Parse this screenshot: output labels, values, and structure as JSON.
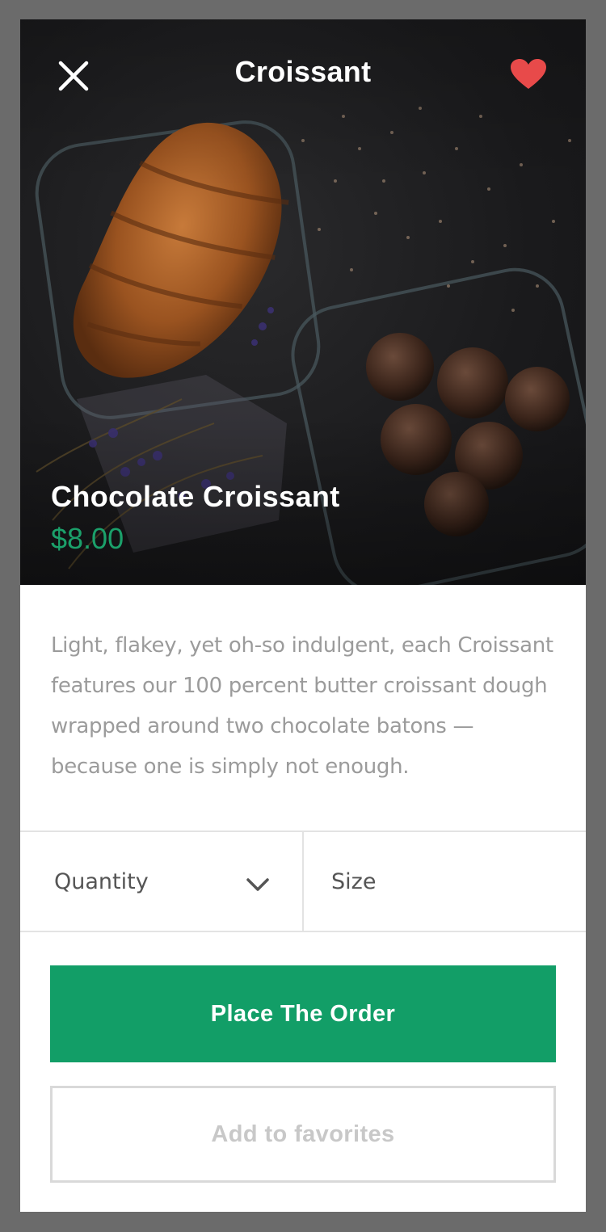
{
  "header": {
    "title": "Croissant",
    "close_icon": "close-icon",
    "favorite_icon": "heart-icon",
    "favorite_color": "#e84a4a"
  },
  "product": {
    "name": "Chocolate Croissant",
    "price": "$8.00",
    "price_color": "#1ba06a",
    "description": "Light, flakey, yet oh-so indulgent, each Croissant features our 100 percent butter croissant dough wrapped around two chocolate batons — because one is simply not enough."
  },
  "options": {
    "quantity_label": "Quantity",
    "size_label": "Size",
    "chevron_icon": "chevron-down-icon"
  },
  "actions": {
    "order_label": "Place The Order",
    "order_color": "#129e67",
    "favorites_label": "Add to favorites"
  }
}
